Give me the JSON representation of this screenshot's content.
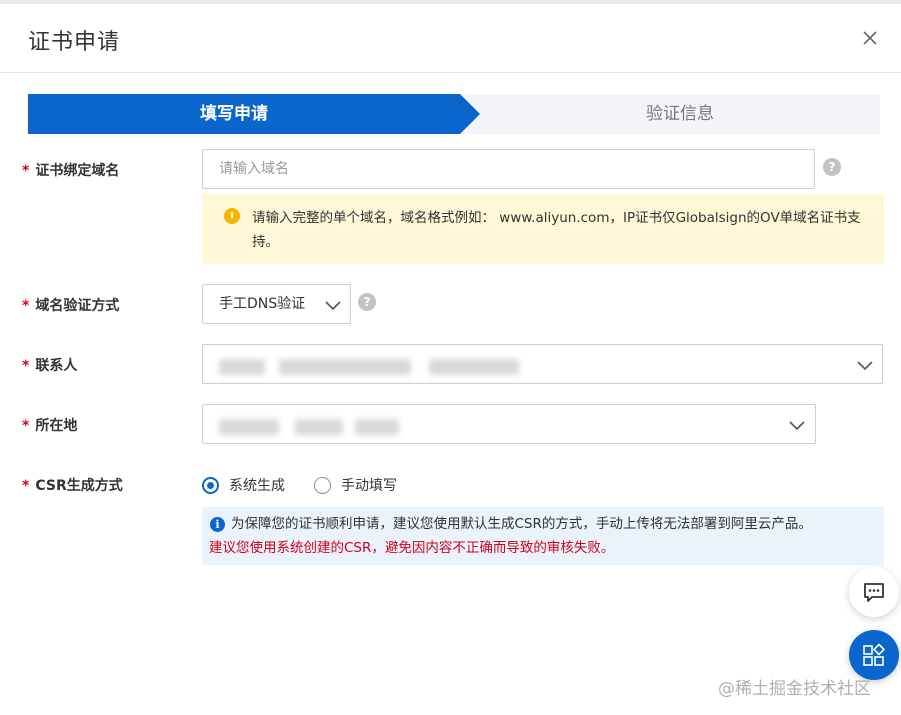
{
  "dialog": {
    "title": "证书申请",
    "close_icon": "close-icon"
  },
  "steps": [
    {
      "label": "填写申请",
      "active": true
    },
    {
      "label": "验证信息",
      "active": false
    }
  ],
  "form": {
    "domain": {
      "label": "证书绑定域名",
      "placeholder": "请输入域名",
      "value": "",
      "warning": "请输入完整的单个域名，域名格式例如： www.aliyun.com，IP证书仅Globalsign的OV单域名证书支持。"
    },
    "verify_method": {
      "label": "域名验证方式",
      "value": "手工DNS验证"
    },
    "contact": {
      "label": "联系人"
    },
    "location": {
      "label": "所在地"
    },
    "csr": {
      "label": "CSR生成方式",
      "options": [
        "系统生成",
        "手动填写"
      ],
      "selected": 0,
      "info_line1": "为保障您的证书顺利申请，建议您使用默认生成CSR的方式，手动上传将无法部署到阿里云产品。",
      "info_line2": "建议您使用系统创建的CSR，避免因内容不正确而导致的审核失败。"
    },
    "required_mark": "*"
  },
  "colors": {
    "primary": "#0a66cc",
    "required": "#d0021b",
    "warning_bg": "#fff7d6",
    "info_bg": "#eaf2fc"
  },
  "watermark": "@稀土掘金技术社区"
}
